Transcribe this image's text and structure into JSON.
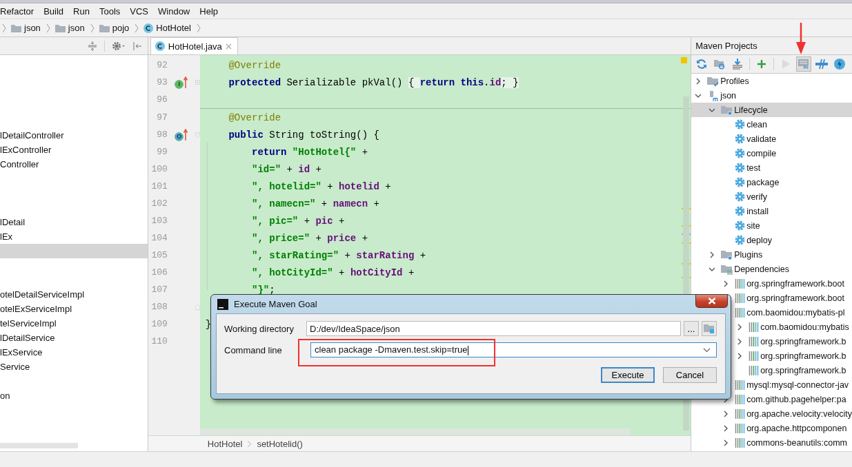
{
  "menu": [
    "Refactor",
    "Build",
    "Run",
    "Tools",
    "VCS",
    "Window",
    "Help"
  ],
  "breadcrumb": [
    {
      "label": "json",
      "kind": "folder"
    },
    {
      "label": "json",
      "kind": "folder"
    },
    {
      "label": "pojo",
      "kind": "folder"
    },
    {
      "label": "HotHotel",
      "kind": "class"
    }
  ],
  "project_tree": [
    {
      "selected": false
    },
    {
      "selected": false
    },
    {
      "selected": false
    },
    {
      "selected": false
    },
    {
      "selected": false
    },
    {
      "text": "lDetailController",
      "selected": false
    },
    {
      "text": "lExController",
      "selected": false
    },
    {
      "text": "Controller",
      "selected": false
    },
    {
      "selected": false
    },
    {
      "selected": false
    },
    {
      "selected": false
    },
    {
      "text": "lDetail",
      "selected": false
    },
    {
      "text": "lEx",
      "selected": false
    },
    {
      "selected": true
    },
    {
      "selected": false
    },
    {
      "selected": false
    },
    {
      "text": "otelDetailServiceImpl",
      "selected": false
    },
    {
      "text": "otelExServiceImpl",
      "selected": false
    },
    {
      "text": "telServiceImpl",
      "selected": false
    },
    {
      "text": "lDetailService",
      "selected": false
    },
    {
      "text": "lExService",
      "selected": false
    },
    {
      "text": "Service",
      "selected": false
    },
    {
      "selected": false
    },
    {
      "text": "on",
      "selected": false
    }
  ],
  "editor": {
    "tabs": [
      {
        "label": "HotHotel.java",
        "selected": true
      }
    ],
    "lines": [
      {
        "number": "92",
        "tokens": [
          {
            "kind": "annotation",
            "text": "    @Override"
          }
        ]
      },
      {
        "number": "93",
        "marker": {
          "kind": "implements",
          "letter": "I"
        },
        "fold": {
          "kind": "collapsed"
        },
        "tokens": [
          {
            "kind": "keyword",
            "text": "    protected"
          },
          {
            "kind": "plain",
            "text": " Serializable pkVal() "
          },
          {
            "kind": "fold",
            "text": "{ "
          },
          {
            "kind": "keyword",
            "text": "return this"
          },
          {
            "kind": "plain",
            "text": "."
          },
          {
            "kind": "field",
            "text": "id"
          },
          {
            "kind": "fold",
            "text": "; }"
          }
        ]
      },
      {
        "number": "96"
      },
      {
        "number": "97",
        "separator": true,
        "tokens": [
          {
            "kind": "annotation",
            "text": "    @Override"
          }
        ]
      },
      {
        "number": "98",
        "marker": {
          "kind": "overrides",
          "letter": "O"
        },
        "fold": {
          "kind": "start"
        },
        "tokens": [
          {
            "kind": "keyword",
            "text": "    public"
          },
          {
            "kind": "plain",
            "text": " String toString() {"
          }
        ]
      },
      {
        "number": "99",
        "tokens": [
          {
            "kind": "keyword",
            "text": "        return"
          },
          {
            "kind": "string",
            "text": " \"HotHotel{\""
          },
          {
            "kind": "plain",
            "text": " +"
          }
        ]
      },
      {
        "number": "100",
        "tokens": [
          {
            "kind": "string",
            "text": "        \"id=\""
          },
          {
            "kind": "plain",
            "text": " + "
          },
          {
            "kind": "field",
            "text": "id"
          },
          {
            "kind": "plain",
            "text": " +"
          }
        ]
      },
      {
        "number": "101",
        "tokens": [
          {
            "kind": "string",
            "text": "        \", hotelid=\""
          },
          {
            "kind": "plain",
            "text": " + "
          },
          {
            "kind": "field",
            "text": "hotelid"
          },
          {
            "kind": "plain",
            "text": " +"
          }
        ]
      },
      {
        "number": "102",
        "tokens": [
          {
            "kind": "string",
            "text": "        \", namecn=\""
          },
          {
            "kind": "plain",
            "text": " + "
          },
          {
            "kind": "field",
            "text": "namecn"
          },
          {
            "kind": "plain",
            "text": " +"
          }
        ]
      },
      {
        "number": "103",
        "tokens": [
          {
            "kind": "string",
            "text": "        \", pic=\""
          },
          {
            "kind": "plain",
            "text": " + "
          },
          {
            "kind": "field",
            "text": "pic"
          },
          {
            "kind": "plain",
            "text": " +"
          }
        ]
      },
      {
        "number": "104",
        "tokens": [
          {
            "kind": "string",
            "text": "        \", price=\""
          },
          {
            "kind": "plain",
            "text": " + "
          },
          {
            "kind": "field",
            "text": "price"
          },
          {
            "kind": "plain",
            "text": " +"
          }
        ]
      },
      {
        "number": "105",
        "tokens": [
          {
            "kind": "string",
            "text": "        \", starRating=\""
          },
          {
            "kind": "plain",
            "text": " + "
          },
          {
            "kind": "field",
            "text": "starRating"
          },
          {
            "kind": "plain",
            "text": " +"
          }
        ]
      },
      {
        "number": "106",
        "tokens": [
          {
            "kind": "string",
            "text": "        \", hotCityId=\""
          },
          {
            "kind": "plain",
            "text": " + "
          },
          {
            "kind": "field",
            "text": "hotCityId"
          },
          {
            "kind": "plain",
            "text": " +"
          }
        ]
      },
      {
        "number": "107",
        "tokens": [
          {
            "kind": "string",
            "text": "        \"}\""
          },
          {
            "kind": "plain",
            "text": ";"
          }
        ]
      },
      {
        "number": "108",
        "fold": {
          "kind": "end"
        }
      },
      {
        "number": "109",
        "tokens": [
          {
            "kind": "plain",
            "text": "}"
          }
        ]
      },
      {
        "number": "110"
      }
    ],
    "breadcrumb": [
      "HotHotel",
      "setHotelid()"
    ]
  },
  "maven": {
    "title": "Maven Projects",
    "toolbar": [
      {
        "kind": "reimport",
        "pressed": false,
        "disabled": false
      },
      {
        "kind": "generate",
        "pressed": false,
        "disabled": false
      },
      {
        "kind": "download",
        "pressed": false,
        "disabled": false
      },
      {
        "kind": "add",
        "pressed": false,
        "disabled": false
      },
      {
        "kind": "run",
        "pressed": false,
        "disabled": true
      },
      {
        "kind": "execute_goal",
        "pressed": true,
        "disabled": false
      },
      {
        "kind": "toggle_offline",
        "pressed": false,
        "disabled": false
      },
      {
        "kind": "skip_tests",
        "pressed": false,
        "disabled": false
      }
    ],
    "tree": [
      {
        "label": "Profiles",
        "kind": "profiles",
        "expanded": false,
        "selected": false
      },
      {
        "label": "json",
        "kind": "module",
        "expanded": true,
        "selected": false,
        "children": [
          {
            "label": "Lifecycle",
            "kind": "folder_gear",
            "expanded": true,
            "selected": true,
            "children": [
              {
                "label": "clean",
                "kind": "goal",
                "selected": false
              },
              {
                "label": "validate",
                "kind": "goal",
                "selected": false
              },
              {
                "label": "compile",
                "kind": "goal",
                "selected": false
              },
              {
                "label": "test",
                "kind": "goal",
                "selected": false
              },
              {
                "label": "package",
                "kind": "goal",
                "selected": false
              },
              {
                "label": "verify",
                "kind": "goal",
                "selected": false
              },
              {
                "label": "install",
                "kind": "goal",
                "selected": false
              },
              {
                "label": "site",
                "kind": "goal",
                "selected": false
              },
              {
                "label": "deploy",
                "kind": "goal",
                "selected": false
              }
            ]
          },
          {
            "label": "Plugins",
            "kind": "folder_gear",
            "expanded": false,
            "selected": false
          },
          {
            "label": "Dependencies",
            "kind": "folder_bars",
            "expanded": true,
            "selected": false,
            "children": [
              {
                "label": "org.springframework.boot",
                "kind": "library",
                "expanded": false,
                "selected": false
              },
              {
                "label": "org.springframework.boot",
                "kind": "library",
                "selected": false
              },
              {
                "label": "com.baomidou:mybatis-pl",
                "kind": "library",
                "selected": false,
                "children": [
                  {
                    "label": "com.baomidou:mybatis",
                    "kind": "library",
                    "expanded": false,
                    "selected": false
                  },
                  {
                    "label": "org.springframework.b",
                    "kind": "library",
                    "expanded": false,
                    "selected": false
                  },
                  {
                    "label": "org.springframework.b",
                    "kind": "library",
                    "expanded": false,
                    "selected": false
                  },
                  {
                    "label": "org.springframework.b",
                    "kind": "library",
                    "selected": false
                  }
                ]
              },
              {
                "label": "mysql:mysql-connector-jav",
                "kind": "library",
                "selected": false
              },
              {
                "label": "com.github.pagehelper:pa",
                "kind": "library",
                "expanded": false,
                "selected": false
              },
              {
                "label": "org.apache.velocity:velocity",
                "kind": "library",
                "expanded": false,
                "selected": false
              },
              {
                "label": "org.apache.httpcomponen",
                "kind": "library",
                "expanded": false,
                "selected": false
              },
              {
                "label": "commons-beanutils:comm",
                "kind": "library",
                "expanded": false,
                "selected": false
              }
            ]
          }
        ]
      }
    ]
  },
  "dialog": {
    "title": "Execute Maven Goal",
    "fields": [
      {
        "label": "Working directory",
        "value": "D:/dev/IdeaSpace/json",
        "kind": "text",
        "browse": "..."
      },
      {
        "label": "Command line",
        "value": "clean package -Dmaven.test.skip=true",
        "kind": "combo",
        "focused": true
      }
    ],
    "buttons": [
      {
        "label": "Execute",
        "default": true
      },
      {
        "label": "Cancel",
        "default": false
      }
    ]
  }
}
